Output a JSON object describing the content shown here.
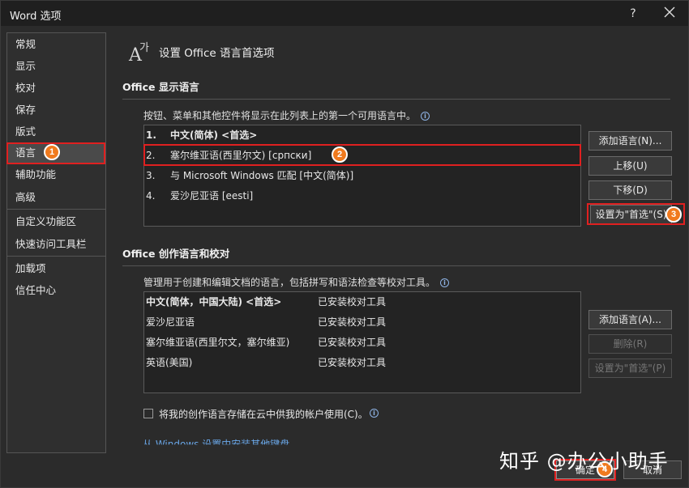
{
  "window": {
    "title": "Word 选项",
    "help": "?"
  },
  "nav": {
    "items": [
      {
        "label": "常规"
      },
      {
        "label": "显示"
      },
      {
        "label": "校对"
      },
      {
        "label": "保存"
      },
      {
        "label": "版式"
      },
      {
        "label": "语言"
      },
      {
        "label": "辅助功能"
      },
      {
        "label": "高级"
      },
      {
        "label": "自定义功能区"
      },
      {
        "label": "快速访问工具栏"
      },
      {
        "label": "加载项"
      },
      {
        "label": "信任中心"
      }
    ],
    "selected": "语言"
  },
  "header": {
    "title": "设置 Office 语言首选项",
    "icon": "language-icon"
  },
  "display_section": {
    "title": "Office 显示语言",
    "description": "按钮、菜单和其他控件将显示在此列表上的第一个可用语言中。",
    "languages": [
      {
        "num": "1.",
        "name": "中文(简体) <首选>"
      },
      {
        "num": "2.",
        "name": "塞尔维亚语(西里尔文) [српски]"
      },
      {
        "num": "3.",
        "name": "与 Microsoft Windows 匹配 [中文(简体)]"
      },
      {
        "num": "4.",
        "name": "爱沙尼亚语 [eesti]"
      }
    ],
    "buttons": {
      "add": "添加语言(N)...",
      "up": "上移(U)",
      "down": "下移(D)",
      "set_preferred": "设置为\"首选\"(S)"
    }
  },
  "authoring_section": {
    "title": "Office 创作语言和校对",
    "description": "管理用于创建和编辑文档的语言，包括拼写和语法检查等校对工具。",
    "languages": [
      {
        "name": "中文(简体，中国大陆) <首选>",
        "status": "已安装校对工具"
      },
      {
        "name": "爱沙尼亚语",
        "status": "已安装校对工具"
      },
      {
        "name": "塞尔维亚语(西里尔文，塞尔维亚)",
        "status": "已安装校对工具"
      },
      {
        "name": "英语(美国)",
        "status": "已安装校对工具"
      }
    ],
    "buttons": {
      "add": "添加语言(A)...",
      "remove": "删除(R)",
      "set_preferred": "设置为\"首选\"(P)"
    },
    "cloud_checkbox": {
      "label": "将我的创作语言存储在云中供我的帐户使用(C)。",
      "checked": false
    },
    "link": "从 Windows 设置中安装其他键盘"
  },
  "footer": {
    "ok": "确定",
    "cancel": "取消"
  },
  "annotations": {
    "badges": [
      "1",
      "2",
      "3",
      "4"
    ]
  },
  "watermark": "知乎 @办公小助手",
  "colors": {
    "background": "#2b2b2b",
    "highlight": "#e02020",
    "badge": "#f07a1e",
    "link": "#6aa7e8"
  }
}
